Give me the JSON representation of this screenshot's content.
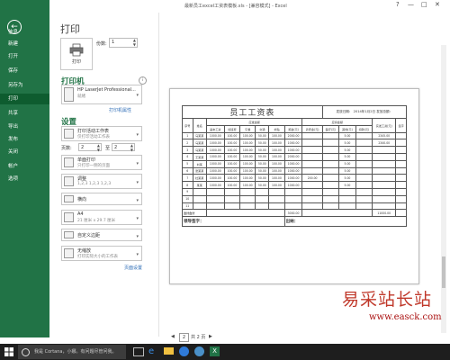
{
  "window": {
    "title": "最新员工excel工资表模板.xls - [兼容模式] - Excel",
    "help": "?",
    "minimize": "—",
    "maximize": "□",
    "close": "✕"
  },
  "nav": {
    "back_icon": "←",
    "items": [
      "信息",
      "新建",
      "打开",
      "保存",
      "另存为",
      "打印",
      "共享",
      "导出",
      "发布",
      "关闭",
      "帐户",
      "选项"
    ],
    "active": "打印"
  },
  "print": {
    "heading": "打印",
    "button_label": "打印",
    "copies_label": "份数:",
    "copies_value": "1"
  },
  "printer": {
    "heading": "打印机",
    "name": "HP LaserJet Professional...",
    "status": "就绪",
    "properties_link": "打印机属性"
  },
  "settings": {
    "heading": "设置",
    "what": {
      "line1": "打印活动工作表",
      "line2": "仅打印活动工作表"
    },
    "pages_label": "页数:",
    "pages_from": "2",
    "pages_to_label": "至",
    "pages_to": "2",
    "sides": {
      "line1": "单面打印",
      "line2": "只打印一侧的页面"
    },
    "collate": {
      "line1": "调整",
      "line2": "1,2,3    1,2,3    1,2,3"
    },
    "orientation": {
      "line1": "横向"
    },
    "paper": {
      "line1": "A4",
      "line2": "21 厘米 x 29.7 厘米"
    },
    "margins": {
      "line1": "自定义边距"
    },
    "scaling": {
      "line1": "无缩放",
      "line2": "打印实际大小的工作表"
    },
    "page_setup_link": "页面设置"
  },
  "preview": {
    "sheet": {
      "title": "员工工资表",
      "date": "发放日期：   2014年1月2日   发放总额：",
      "col_headers": [
        "序号",
        "姓名",
        "应发金额",
        "",
        "",
        "",
        "",
        "",
        "应扣金额",
        "",
        "",
        "",
        "实发工资(元)",
        "签字"
      ],
      "sub_headers": [
        "",
        "",
        "基本工资",
        "加班费",
        "午餐",
        "交通",
        "补贴",
        "奖金(元)",
        "养老金(元)",
        "医疗(元)",
        "其他(元)",
        "扣款(元)",
        "",
        ""
      ],
      "rows": [
        [
          "1",
          "马某某",
          "1000.00",
          "100.00",
          "100.00",
          "50.00",
          "100.00",
          "2000.00",
          "",
          "",
          "5.00",
          "",
          "2345.00",
          ""
        ],
        [
          "2",
          "马某某",
          "1000.00",
          "100.00",
          "100.00",
          "50.00",
          "100.00",
          "1000.00",
          "",
          "",
          "5.00",
          "",
          "2340.00",
          ""
        ],
        [
          "3",
          "马某某",
          "1000.00",
          "100.00",
          "100.00",
          "50.00",
          "100.00",
          "1000.00",
          "",
          "",
          "5.00",
          "",
          "",
          ""
        ],
        [
          "4",
          "王某某",
          "1000.00",
          "100.00",
          "100.00",
          "50.00",
          "100.00",
          "2000.00",
          "",
          "",
          "5.00",
          "",
          "",
          ""
        ],
        [
          "5",
          "刘某",
          "1000.00",
          "100.00",
          "100.00",
          "50.00",
          "100.00",
          "1000.00",
          "",
          "",
          "5.00",
          "",
          "",
          ""
        ],
        [
          "6",
          "张某某",
          "1000.00",
          "100.00",
          "100.00",
          "50.00",
          "100.00",
          "1000.00",
          "",
          "",
          "5.00",
          "",
          "",
          ""
        ],
        [
          "7",
          "杜某某",
          "1000.00",
          "100.00",
          "100.00",
          "50.00",
          "100.00",
          "1000.00",
          "200.00",
          "",
          "5.00",
          "",
          "",
          ""
        ],
        [
          "8",
          "某某",
          "1000.00",
          "100.00",
          "100.00",
          "50.00",
          "100.00",
          "1000.00",
          "",
          "",
          "5.00",
          "",
          "",
          ""
        ],
        [
          "9",
          "",
          "",
          "",
          "",
          "",
          "",
          "",
          "",
          "",
          "",
          "",
          "",
          ""
        ],
        [
          "10",
          "",
          "",
          "",
          "",
          "",
          "",
          "",
          "",
          "",
          "",
          "",
          "",
          ""
        ],
        [
          "11",
          "",
          "",
          "",
          "",
          "",
          "",
          "",
          "",
          "",
          "",
          "",
          "",
          ""
        ]
      ],
      "total_label": "合计合计",
      "total_value": "3000.00",
      "total_right": "11000.00",
      "sign_label": "领导签字：",
      "cashier_label": "出纳："
    },
    "pager": {
      "prev": "◀",
      "page": "2",
      "of": "共 2 页",
      "next": "▶"
    }
  },
  "taskbar": {
    "start_icon": "windows-logo",
    "search_placeholder": "我是 Cortana，小娜。有问题尽管问我。"
  },
  "watermark": {
    "text": "易采站长站",
    "url": "www.easck.com"
  },
  "colors": {
    "accent": "#217346",
    "accent_dark": "#0e5c2f",
    "taskbar": "#1e1e1e",
    "watermark": "#c0392b"
  }
}
